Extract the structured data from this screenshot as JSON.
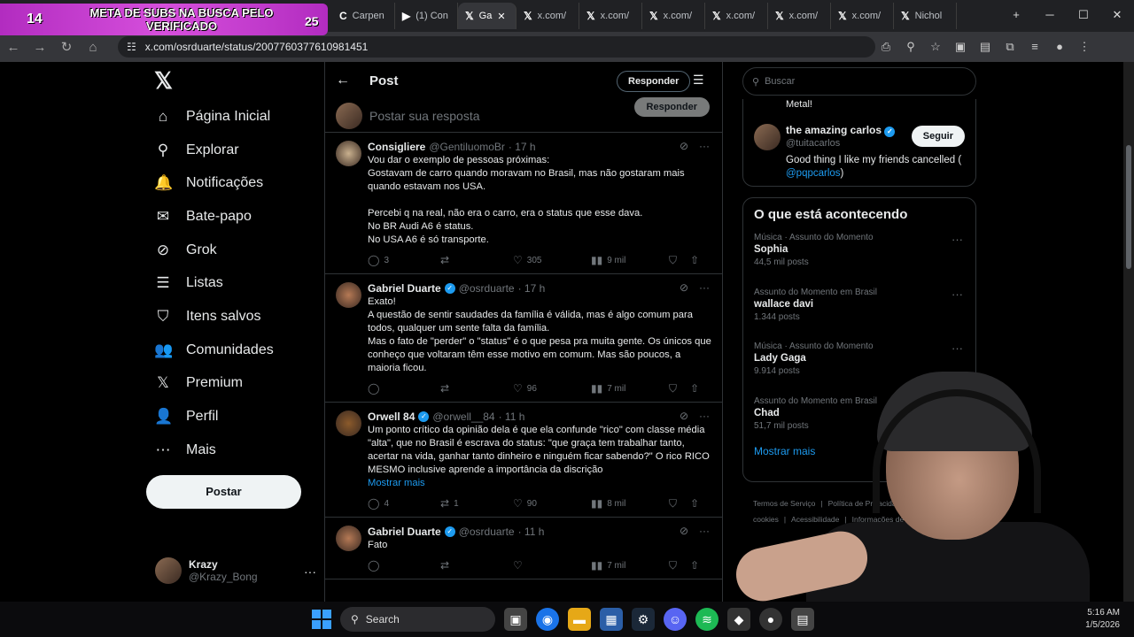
{
  "overlay": {
    "count_left": "14",
    "title": "META DE SUBS NA BUSCA PELO VERIFICADO",
    "count_right": "25"
  },
  "browser": {
    "tabs": [
      {
        "fav": "C",
        "label": "Carpen"
      },
      {
        "fav": "▶",
        "label": "(1) Con"
      },
      {
        "fav": "𝕏",
        "label": "Ga"
      },
      {
        "fav": "𝕏",
        "label": "x.com/"
      },
      {
        "fav": "𝕏",
        "label": "x.com/"
      },
      {
        "fav": "𝕏",
        "label": "x.com/"
      },
      {
        "fav": "𝕏",
        "label": "x.com/"
      },
      {
        "fav": "𝕏",
        "label": "x.com/"
      },
      {
        "fav": "𝕏",
        "label": "x.com/"
      },
      {
        "fav": "𝕏",
        "label": "Nichol"
      }
    ],
    "url": "x.com/osrduarte/status/2007760377610981451"
  },
  "nav": {
    "items": [
      {
        "icon": "home-icon",
        "glyph": "⌂",
        "label": "Página Inicial"
      },
      {
        "icon": "search-icon",
        "glyph": "⚲",
        "label": "Explorar"
      },
      {
        "icon": "bell-icon",
        "glyph": "🔔",
        "label": "Notificações"
      },
      {
        "icon": "mail-icon",
        "glyph": "✉",
        "label": "Bate-papo"
      },
      {
        "icon": "grok-icon",
        "glyph": "⊘",
        "label": "Grok"
      },
      {
        "icon": "list-icon",
        "glyph": "☰",
        "label": "Listas"
      },
      {
        "icon": "bookmark-icon",
        "glyph": "⛉",
        "label": "Itens salvos"
      },
      {
        "icon": "community-icon",
        "glyph": "👥",
        "label": "Comunidades"
      },
      {
        "icon": "x-icon",
        "glyph": "𝕏",
        "label": "Premium"
      },
      {
        "icon": "profile-icon",
        "glyph": "👤",
        "label": "Perfil"
      },
      {
        "icon": "more-circle-icon",
        "glyph": "⋯",
        "label": "Mais"
      }
    ],
    "post_button": "Postar",
    "account": {
      "name": "Krazy",
      "handle": "@Krazy_Bong"
    }
  },
  "main": {
    "title": "Post",
    "reply_pill": "Responder",
    "composer_placeholder": "Postar sua resposta",
    "composer_button": "Responder",
    "tweets": [
      {
        "name": "Consigliere",
        "handle": "@GentiluomoBr",
        "time": "· 17 h",
        "verified": false,
        "text": "Vou dar o exemplo de pessoas próximas:\nGostavam de carro quando moravam no Brasil, mas não gostaram mais quando estavam nos USA.\n\nPercebi q na real, não era o carro, era o status que esse dava.\nNo BR Audi A6 é status.\nNo USA A6 é só transporte.",
        "more": "",
        "replies": "3",
        "reposts": "",
        "likes": "305",
        "views": "9 mil"
      },
      {
        "name": "Gabriel Duarte",
        "handle": "@osrduarte",
        "time": "· 17 h",
        "verified": true,
        "text": "Exato!\nA questão de sentir saudades da família é válida, mas é algo comum para todos, qualquer um sente falta da família.\nMas o fato de \"perder\" o \"status\" é o que pesa pra muita gente. Os únicos que conheço que voltaram têm esse motivo em comum. Mas são poucos, a maioria ficou.",
        "more": "",
        "replies": "",
        "reposts": "",
        "likes": "96",
        "views": "7 mil"
      },
      {
        "name": "Orwell 84",
        "handle": "@orwell__84",
        "time": "· 11 h",
        "verified": true,
        "text": "Um ponto crítico da opinião dela é que ela confunde \"rico\" com classe média \"alta\", que no Brasil é escrava do status: \"que graça tem trabalhar tanto, acertar na vida, ganhar tanto dinheiro e ninguém ficar sabendo?\" O rico RICO MESMO inclusive aprende a importância da discrição",
        "more": "Mostrar mais",
        "replies": "4",
        "reposts": "1",
        "likes": "90",
        "views": "8 mil"
      },
      {
        "name": "Gabriel Duarte",
        "handle": "@osrduarte",
        "time": "· 11 h",
        "verified": true,
        "text": "Fato",
        "more": "",
        "replies": "",
        "reposts": "",
        "likes": "",
        "views": "7 mil"
      }
    ]
  },
  "sidebar": {
    "search_placeholder": "Buscar",
    "prev_text": "Metal!",
    "suggestion": {
      "name": "the amazing carlos",
      "handle": "@tuitacarlos",
      "bio": "Good thing I like my friends cancelled (",
      "bio_link": "@pqpcarlos",
      "bio_end": ")",
      "follow": "Seguir"
    },
    "trends_title": "O que está acontecendo",
    "trends": [
      {
        "context": "Música · Assunto do Momento",
        "title": "Sophia",
        "posts": "44,5 mil posts"
      },
      {
        "context": "Assunto do Momento em Brasil",
        "title": "wallace davi",
        "posts": "1.344 posts"
      },
      {
        "context": "Música · Assunto do Momento",
        "title": "Lady Gaga",
        "posts": "9.914 posts"
      },
      {
        "context": "Assunto do Momento em Brasil",
        "title": "Chad",
        "posts": "51,7 mil posts"
      }
    ],
    "show_more": "Mostrar mais",
    "footer": [
      "Termos de Serviço",
      "|",
      "Política de Privacidade",
      "Política de cookies",
      "|",
      "Acessibilidade",
      "|",
      "Informações de anúncios",
      "|",
      "Ma"
    ]
  },
  "taskbar": {
    "search": "Search",
    "time": "5:16 AM",
    "date": "1/5/2026"
  }
}
